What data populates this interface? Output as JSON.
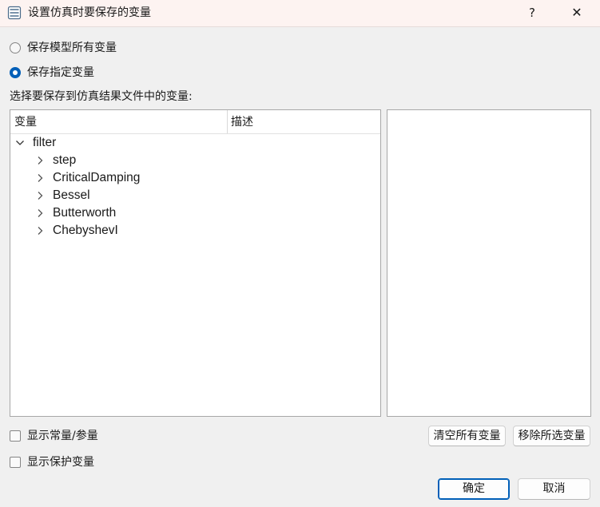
{
  "window": {
    "title": "设置仿真时要保存的变量",
    "help_label": "?",
    "close_label": "✕"
  },
  "options": {
    "save_all_label": "保存模型所有变量",
    "save_specified_label": "保存指定变量",
    "selected": "save_specified"
  },
  "section_label": "选择要保存到仿真结果文件中的变量:",
  "tree": {
    "columns": [
      "变量",
      "描述"
    ],
    "root": {
      "label": "filter",
      "expanded": true
    },
    "children": [
      "step",
      "CriticalDamping",
      "Bessel",
      "Butterworth",
      "ChebyshevI"
    ]
  },
  "checkboxes": {
    "show_constants_label": "显示常量/参量",
    "show_protected_label": "显示保护变量"
  },
  "buttons": {
    "clear_all_label": "清空所有变量",
    "remove_selected_label": "移除所选变量",
    "ok_label": "确定",
    "cancel_label": "取消"
  },
  "colors": {
    "accent": "#005fb8",
    "titlebar_bg": "#fdf3f1",
    "dialog_bg": "#f0f0f0"
  }
}
